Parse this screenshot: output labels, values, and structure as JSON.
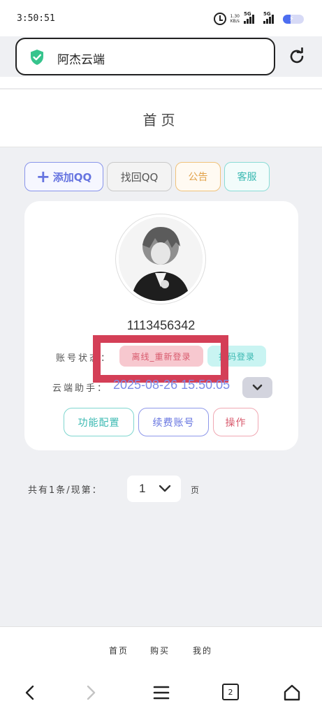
{
  "status_bar": {
    "time": "3:50:51",
    "net_speed_top": "1.30",
    "net_speed_bottom": "KB/s",
    "signal_1": "5G",
    "signal_2": "5G",
    "battery_level": 0.35
  },
  "browser": {
    "address_title": "阿杰云端",
    "tab_count": "2"
  },
  "header": {
    "title": "首页"
  },
  "toolbar": {
    "add_plus": "+",
    "add_label": "添加QQ",
    "find_label": "找回QQ",
    "notice_label": "公告",
    "service_label": "客服"
  },
  "account": {
    "qq_number": "1113456342",
    "status_label": "账号状态：",
    "status_value": "离线_重新登录",
    "scan_login": "扫码登录",
    "assistant_label": "云端助手：",
    "expire_time": "2025-08-26 15:50:05",
    "config_button": "功能配置",
    "renew_button": "续费账号",
    "operate_button": "操作"
  },
  "pager": {
    "summary": "共有1条/现第：",
    "current_page": "1",
    "unit": "页"
  },
  "tabbar": {
    "home": "首页",
    "buy": "购买",
    "me": "我的"
  },
  "colors": {
    "primary": "#6674e0",
    "teal": "#3ab9b2",
    "orange": "#e2a24a",
    "danger": "#d85b6e",
    "highlight_box": "#d43f57"
  }
}
